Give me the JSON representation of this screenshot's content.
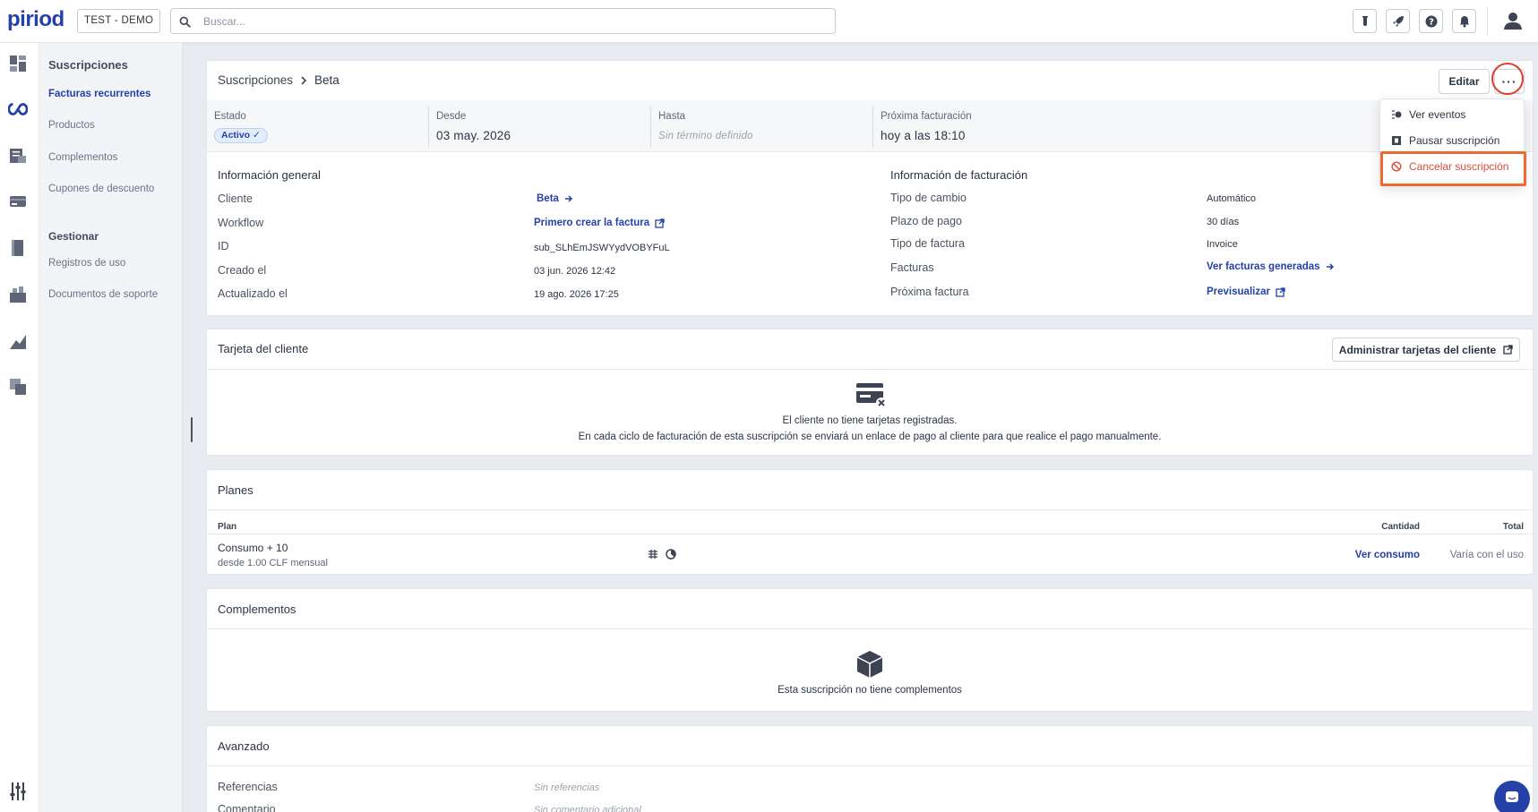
{
  "header": {
    "logo": "piriod",
    "environment": "TEST - DEMO",
    "search_placeholder": "Buscar..."
  },
  "subnav": {
    "section1_title": "Suscripciones",
    "items1": [
      "Facturas recurrentes",
      "Productos",
      "Complementos",
      "Cupones de descuento"
    ],
    "section2_title": "Gestionar",
    "items2": [
      "Registros de uso",
      "Documentos de soporte"
    ]
  },
  "breadcrumb": {
    "parent": "Suscripciones",
    "current": "Beta"
  },
  "actions": {
    "edit": "Editar",
    "more": "..."
  },
  "menu": {
    "events": "Ver eventos",
    "pause": "Pausar suscripción",
    "cancel": "Cancelar suscripción"
  },
  "status": {
    "estado_label": "Estado",
    "estado_value": "Activo ✓",
    "desde_label": "Desde",
    "desde_value": "03 may. 2026",
    "hasta_label": "Hasta",
    "hasta_value": "Sin término definido",
    "proxima_label": "Próxima facturación",
    "proxima_value": "hoy a las 18:10"
  },
  "general": {
    "title": "Información general",
    "cliente_label": "Cliente",
    "cliente_value": "Beta",
    "workflow_label": "Workflow",
    "workflow_value": "Primero crear la factura",
    "id_label": "ID",
    "id_value": "sub_SLhEmJSWYydVOBYFuL",
    "creado_label": "Creado el",
    "creado_value": "03 jun. 2026 12:42",
    "actualizado_label": "Actualizado el",
    "actualizado_value": "19 ago. 2026 17:25"
  },
  "billing": {
    "title": "Información de facturación",
    "tipo_cambio_label": "Tipo de cambio",
    "tipo_cambio_value": "Automático",
    "plazo_label": "Plazo de pago",
    "plazo_value": "30 días",
    "tipo_factura_label": "Tipo de factura",
    "tipo_factura_value": "Invoice",
    "facturas_label": "Facturas",
    "facturas_value": "Ver facturas generadas",
    "proxima_factura_label": "Próxima factura",
    "proxima_factura_value": "Previsualizar"
  },
  "card_section": {
    "title": "Tarjeta del cliente",
    "manage_button": "Administrar tarjetas del cliente",
    "empty_line1": "El cliente no tiene tarjetas registradas.",
    "empty_line2": "En cada ciclo de facturación de esta suscripción se enviará un enlace de pago al cliente para que realice el pago manualmente."
  },
  "plans": {
    "title": "Planes",
    "columns": {
      "plan": "Plan",
      "cantidad": "Cantidad",
      "total": "Total"
    },
    "rows": [
      {
        "name": "Consumo + 10",
        "price": "desde 1.00 CLF mensual",
        "cantidad": "Ver consumo",
        "total": "Varía con el uso"
      }
    ]
  },
  "addons": {
    "title": "Complementos",
    "empty": "Esta suscripción no tiene complementos"
  },
  "advanced": {
    "title": "Avanzado",
    "referencias_label": "Referencias",
    "referencias_value": "Sin referencias",
    "comentario_label": "Comentario",
    "comentario_value": "Sin comentario adicional"
  },
  "colors": {
    "brand": "#2541a8",
    "danger": "#d94b3b",
    "highlight": "#ee6a2f"
  }
}
